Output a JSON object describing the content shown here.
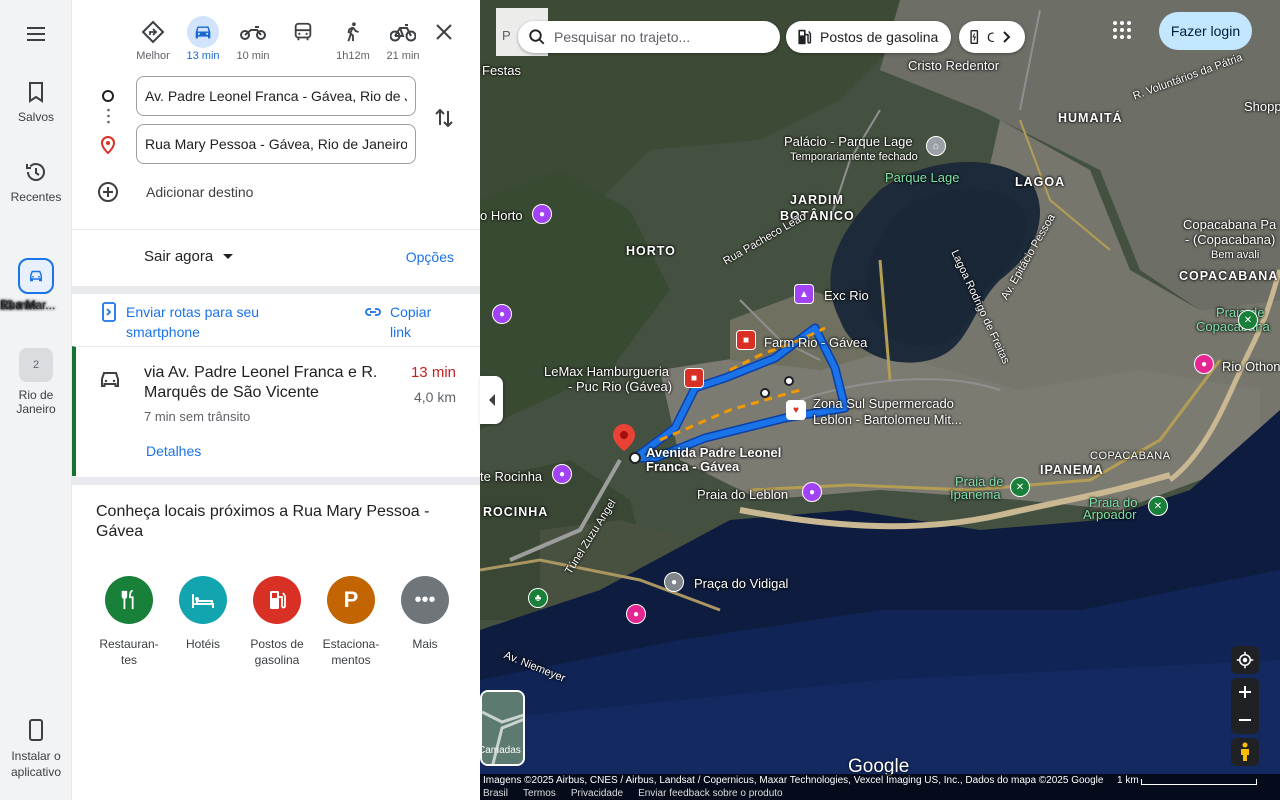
{
  "rail": {
    "menu_icon": "menu-icon",
    "saved_label": "Salvos",
    "recent_label": "Recentes",
    "route_label": "Rua Mar...",
    "route_time": "13 min",
    "place_label": "Rio de Janeiro",
    "place_badge": "2",
    "install_label": "Instalar o aplicativo"
  },
  "modes": [
    {
      "name": "Melhor",
      "label": "Melhor",
      "icon": "best-route-icon"
    },
    {
      "name": "car",
      "label": "13 min",
      "icon": "car-icon",
      "active": true
    },
    {
      "name": "motorcycle",
      "label": "10 min",
      "icon": "motorcycle-icon"
    },
    {
      "name": "transit",
      "label": "",
      "icon": "bus-icon"
    },
    {
      "name": "walk",
      "label": "1h12m",
      "icon": "walk-icon"
    },
    {
      "name": "bike",
      "label": "21 min",
      "icon": "bike-icon"
    }
  ],
  "origin": "Av. Padre Leonel Franca - Gávea, Rio de Janeiro",
  "destination": "Rua Mary Pessoa - Gávea, Rio de Janeiro",
  "add_destination": "Adicionar destino",
  "leave_now": "Sair agora",
  "options": "Opções",
  "send_routes": "Enviar rotas para seu smartphone",
  "copy_link": "Copiar link",
  "route_card": {
    "title": "via Av. Padre Leonel Franca e R. Marquês de São Vicente",
    "time": "13 min",
    "distance": "4,0 km",
    "subtitle": "7 min sem trânsito",
    "details": "Detalhes"
  },
  "nearby_title": "Conheça locais próximos a Rua Mary Pessoa - Gávea",
  "categories": [
    {
      "label": "Restauran-tes",
      "icon": "restaurant-icon",
      "color": "#188038"
    },
    {
      "label": "Hotéis",
      "icon": "hotel-icon",
      "color": "#12a4af"
    },
    {
      "label": "Postos de gasolina",
      "icon": "gas-station-icon",
      "color": "#d93025"
    },
    {
      "label": "Estaciona-mentos",
      "icon": "parking-icon",
      "color": "#c26401"
    },
    {
      "label": "Mais",
      "icon": "more-icon",
      "color": "#70757a"
    }
  ],
  "map": {
    "search_placeholder": "Pesquisar no trajeto...",
    "p_fragment": "P",
    "chip_gas": "Postos de gasolina",
    "chip_ev": "C",
    "login": "Fazer login",
    "labels": {
      "festas": "Festas",
      "cristo": "Cristo Redentor",
      "humaita": "HUMAITÁ",
      "shopping": "Shopping",
      "parque_lage": "Palácio - Parque Lage",
      "temp_closed": "Temporariamente fechado",
      "parque_lage2": "Parque Lage",
      "jardim": "JARDIM",
      "botanico": "BOTÂNICO",
      "lagoa": "LAGOA",
      "horto_poi": "o Horto",
      "horto": "HORTO",
      "rua_pacheco": "Rua Pacheco Leão",
      "lagoa_rodrigo": "Lagoa Rodrigo de Freitas",
      "av_epitacio": "Av. Epitácio Pessoa",
      "copacabana_pa": "Copacabana Pa",
      "copacabana_pa2": "- (Copacabana)",
      "bem_ava": "Bem avali",
      "copacabana": "COPACABANA",
      "exc_rio": "Exc Rio",
      "farm": "Farm Rio - Gávea",
      "lemax1": "LeMax Hamburgueria",
      "lemax2": "- Puc Rio (Gávea)",
      "zonasul1": "Zona Sul Supermercado",
      "zonasul2": "Leblon - Bartolomeu Mit...",
      "av_padre1": "Avenida Padre Leonel",
      "av_padre2": "Franca - Gávea",
      "praia_cop": "Praia de",
      "praia_cop2": "Copacabana",
      "rio_othon": "Rio Othon",
      "te_rocinha": "te Rocinha",
      "praia_leblon": "Praia do Leblon",
      "copacabana_s": "COPACABANA",
      "ipanema": "IPANEMA",
      "praia_ipa": "Praia de",
      "praia_ipa2": "Ipanema",
      "praia_arp": "Praia do",
      "praia_arp2": "Arpoador",
      "rocinha": "ROCINHA",
      "tunel": "Túnel Zuzu Angel",
      "vidigal": "Praça do Vidigal",
      "niemeyer": "Av. Niemeyer",
      "r_voluntarios": "R. Voluntários da Pátria"
    },
    "layers_label": "Camadas",
    "google": "Google",
    "attribution": "Imagens ©2025 Airbus, CNES / Airbus, Landsat / Copernicus, Maxar Technologies, Vexcel Imaging US, Inc., Dados do mapa ©2025 Google",
    "scale": "1 km",
    "footer_links": [
      "Brasil",
      "Termos",
      "Privacidade",
      "Enviar feedback sobre o produto"
    ],
    "route_color": "#1a73e8",
    "traffic_color": "#f29900"
  }
}
